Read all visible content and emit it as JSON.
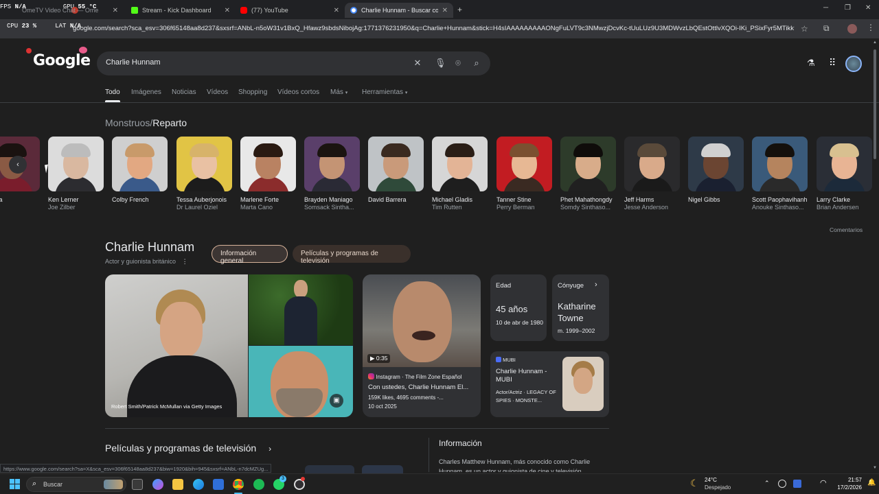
{
  "overlay": {
    "fps_label": "FPS",
    "fps_value": "N/A",
    "gpu_label": "GPU",
    "gpu_value": "55 °C",
    "cpu_label": "CPU",
    "cpu_value": "23 %",
    "lat_label": "LAT",
    "lat_value": "N/A"
  },
  "browser": {
    "tabs": [
      {
        "label": "OmeTV Video Chat — Ome",
        "icon": "video-chat-icon",
        "color": "#c0392b",
        "active": false
      },
      {
        "label": "Stream - Kick Dashboard",
        "icon": "kick-icon",
        "color": "#53fc18",
        "active": false
      },
      {
        "label": "(77) YouTube",
        "icon": "youtube-icon",
        "color": "#ff0000",
        "active": false
      },
      {
        "label": "Charlie Hunnam - Buscar con G",
        "icon": "google-icon",
        "color": "#4285f4",
        "active": true
      }
    ],
    "new_tab": "+",
    "url": "google.com/search?sca_esv=306f65148aa8d237&sxsrf=ANbL-n5oW31v1BxQ_Hfawz9sbdsNibojAg:1771376231950&q=Charlie+Hunnam&stick=H4sIAAAAAAAAAONgFuLVT9c3NMwzjDcvKc-tUuLUz9U3MDWvzLbQEstOttlvXQOi-IKi_PSixFyr5MTikkWsfM4Zi..."
  },
  "google": {
    "logo": "Google",
    "query": "Charlie Hunnam",
    "tabs": [
      "Todo",
      "Imágenes",
      "Noticias",
      "Vídeos",
      "Shopping",
      "Vídeos cortos",
      "Más",
      "Herramientas"
    ]
  },
  "cast": {
    "breadcrumb_parent": "Monstruos",
    "breadcrumb_sep": "/",
    "breadcrumb_current": "Reparto",
    "people": [
      {
        "name": "Malina",
        "role": "",
        "skin": "#8a5a44",
        "hair": "#1a1210",
        "bg": "#5b2a3a",
        "shirt": "#7a1d2c"
      },
      {
        "name": "Ken Lerner",
        "role": "Joe Zilber",
        "skin": "#d9b8a0",
        "hair": "#bcbcbc",
        "bg": "#dcdcdc",
        "shirt": "#2c2c30"
      },
      {
        "name": "Colby French",
        "role": "",
        "skin": "#e2a882",
        "hair": "#c89a6a",
        "bg": "#cfcfcf",
        "shirt": "#3a5a8a"
      },
      {
        "name": "Tessa Auberjonois",
        "role": "Dr Laurel Oziel",
        "skin": "#e9c1a3",
        "hair": "#d7b36a",
        "bg": "#e1c445",
        "shirt": "#1c1c1c"
      },
      {
        "name": "Marlene Forte",
        "role": "Marta Cano",
        "skin": "#b98262",
        "hair": "#2a1a12",
        "bg": "#e8e8e8",
        "shirt": "#8b2c2c"
      },
      {
        "name": "Brayden Maniago",
        "role": "Somsack Sintha...",
        "skin": "#c49474",
        "hair": "#1a1410",
        "bg": "#5a3f6a",
        "shirt": "#2a2a35"
      },
      {
        "name": "David Barrera",
        "role": "",
        "skin": "#c99a7a",
        "hair": "#3a2a20",
        "bg": "#bfc3c6",
        "shirt": "#2f4a3a"
      },
      {
        "name": "Michael Gladis",
        "role": "Tim Rutten",
        "skin": "#e3b496",
        "hair": "#2a1e16",
        "bg": "#d6d6d6",
        "shirt": "#1e1e1e"
      },
      {
        "name": "Tanner Stine",
        "role": "Perry Berman",
        "skin": "#e7b894",
        "hair": "#7a5030",
        "bg": "#c21c22",
        "shirt": "#3a2a22"
      },
      {
        "name": "Phet Mahathongdy",
        "role": "Somdy Sinthaso...",
        "skin": "#d8ac8a",
        "hair": "#0f0c0a",
        "bg": "#2d3b2a",
        "shirt": "#202020"
      },
      {
        "name": "Jeff Harms",
        "role": "Jesse Anderson",
        "skin": "#d9aa8a",
        "hair": "#5a4a3a",
        "bg": "#2a2a2c",
        "shirt": "#1a1a1a"
      },
      {
        "name": "Nigel Gibbs",
        "role": "",
        "skin": "#6b4532",
        "hair": "#d0d0d0",
        "bg": "#2e3a48",
        "shirt": "#1a2030"
      },
      {
        "name": "Scott Paophavihanh",
        "role": "Anouke Sinthaso...",
        "skin": "#b5845e",
        "hair": "#14100c",
        "bg": "#3a5a7a",
        "shirt": "#2a2a2a"
      },
      {
        "name": "Larry Clarke",
        "role": "Brian Andersen",
        "skin": "#e8b494",
        "hair": "#d8c090",
        "bg": "#2a2e36",
        "shirt": "#1c2a3a"
      }
    ],
    "feedback": "Comentarios"
  },
  "entity": {
    "title": "Charlie Hunnam",
    "subtitle": "Actor y guionista británico",
    "chips": [
      "Información general",
      "Películas y programas de televisión"
    ],
    "photo_credit": "Robert Smith/Patrick McMullan via Getty Images",
    "video": {
      "duration": "0:35",
      "source": "Instagram · The Film Zone Español",
      "title": "Con ustedes, Charlie Hunnam El...",
      "stats": "159K likes, 4695 comments -...",
      "date": "10 oct 2025"
    },
    "age_card": {
      "label": "Edad",
      "value": "45 años",
      "detail": "10 de abr de 1980"
    },
    "spouse_card": {
      "label": "Cónyuge",
      "value": "Katharine Towne",
      "detail": "m. 1999–2002"
    },
    "mubi_card": {
      "source": "MUBI",
      "title": "Charlie Hunnam - MUBI",
      "detail": "Actor/Actriz · LEGACY OF SPIES · MONSTE..."
    }
  },
  "bottom": {
    "films_title": "Películas y programas de televisión",
    "info_title": "Información",
    "info_desc": "Charles Matthew Hunnam, más conocido como Charlie Hunnam, es un actor y guionista de cine y televisión"
  },
  "status_url": "https://www.google.com/search?sa=X&sca_esv=306f65148aa8d237&biw=1920&bih=945&sxsrf=ANbL-n7dcMZUg...",
  "taskbar": {
    "search_placeholder": "Buscar",
    "weather_temp": "24°C",
    "weather_desc": "Despejado",
    "time": "21:57",
    "date": "17/2/2026",
    "badge": "3"
  }
}
